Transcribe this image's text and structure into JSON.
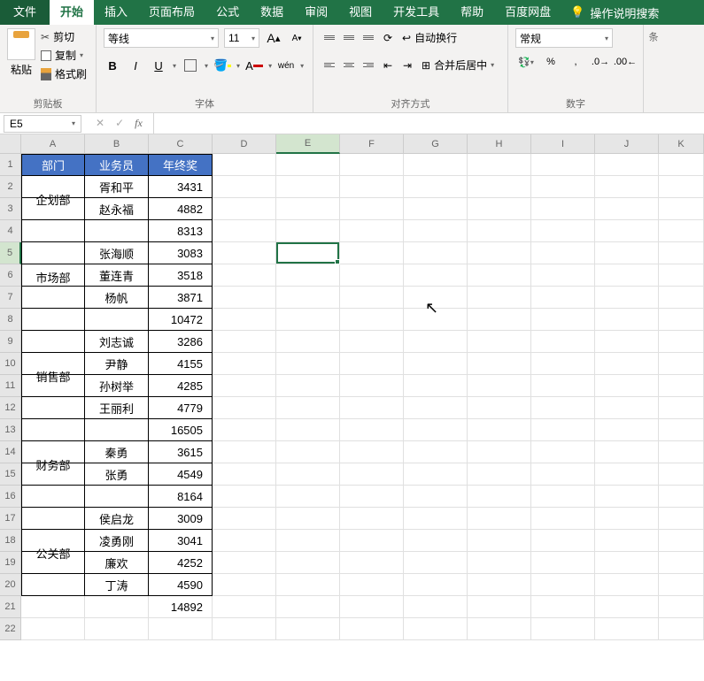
{
  "menu": {
    "file": "文件",
    "home": "开始",
    "insert": "插入",
    "pageLayout": "页面布局",
    "formulas": "公式",
    "data": "数据",
    "review": "审阅",
    "view": "视图",
    "dev": "开发工具",
    "help": "帮助",
    "baidu": "百度网盘",
    "search": "操作说明搜索"
  },
  "ribbon": {
    "clipboard": {
      "paste": "粘贴",
      "cut": "剪切",
      "copy": "复制",
      "format": "格式刷",
      "label": "剪贴板"
    },
    "font": {
      "name": "等线",
      "size": "11",
      "bold": "B",
      "italic": "I",
      "underline": "U",
      "wen": "wén",
      "label": "字体"
    },
    "align": {
      "wrap": "自动换行",
      "merge": "合并后居中",
      "label": "对齐方式"
    },
    "number": {
      "format": "常规",
      "percent": "%",
      "comma": ",",
      "label": "数字"
    },
    "cond": "条"
  },
  "namebox": {
    "ref": "E5"
  },
  "columns": [
    "A",
    "B",
    "C",
    "D",
    "E",
    "F",
    "G",
    "H",
    "I",
    "J",
    "K"
  ],
  "headers": {
    "dept": "部门",
    "sales": "业务员",
    "bonus": "年终奖"
  },
  "rows": [
    {
      "r": 2,
      "dept": "企划部",
      "deptSpan": 2,
      "b": "胥和平",
      "c": "3431"
    },
    {
      "r": 3,
      "b": "赵永福",
      "c": "4882"
    },
    {
      "r": 4,
      "b": "",
      "c": "8313"
    },
    {
      "r": 5,
      "dept": "市场部",
      "deptSpan": 3,
      "b": "张海顺",
      "c": "3083"
    },
    {
      "r": 6,
      "b": "董连青",
      "c": "3518"
    },
    {
      "r": 7,
      "b": "杨帆",
      "c": "3871"
    },
    {
      "r": 8,
      "b": "",
      "c": "10472"
    },
    {
      "r": 9,
      "dept": "销售部",
      "deptSpan": 4,
      "b": "刘志诚",
      "c": "3286"
    },
    {
      "r": 10,
      "b": "尹静",
      "c": "4155"
    },
    {
      "r": 11,
      "b": "孙树举",
      "c": "4285"
    },
    {
      "r": 12,
      "b": "王丽利",
      "c": "4779"
    },
    {
      "r": 13,
      "b": "",
      "c": "16505"
    },
    {
      "r": 14,
      "dept": "财务部",
      "deptSpan": 2,
      "b": "秦勇",
      "c": "3615"
    },
    {
      "r": 15,
      "b": "张勇",
      "c": "4549"
    },
    {
      "r": 16,
      "b": "",
      "c": "8164"
    },
    {
      "r": 17,
      "dept": "公关部",
      "deptSpan": 4,
      "b": "侯启龙",
      "c": "3009"
    },
    {
      "r": 18,
      "b": "凌勇刚",
      "c": "3041"
    },
    {
      "r": 19,
      "b": "廉欢",
      "c": "4252"
    },
    {
      "r": 20,
      "b": "丁涛",
      "c": "4590"
    },
    {
      "r": 21,
      "noborder": true,
      "b": "",
      "c": "14892"
    },
    {
      "r": 22,
      "noborder": true,
      "b": "",
      "c": ""
    }
  ]
}
